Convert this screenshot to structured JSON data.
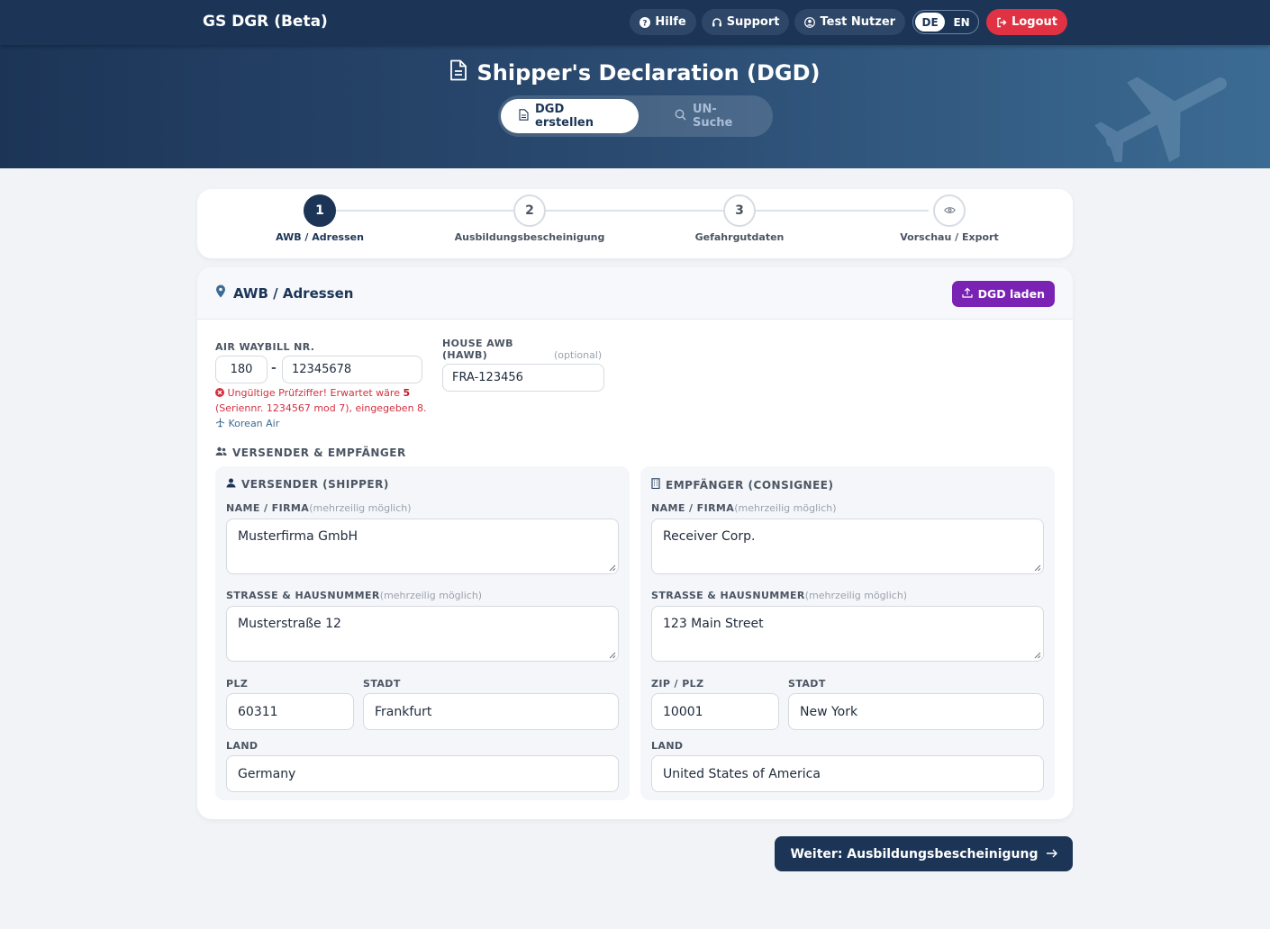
{
  "nav": {
    "brand": "GS DGR (Beta)",
    "help": "Hilfe",
    "support": "Support",
    "user": "Test Nutzer",
    "lang_de": "DE",
    "lang_en": "EN",
    "logout": "Logout"
  },
  "hero": {
    "title": "Shipper's Declaration (DGD)",
    "tabs": [
      {
        "label": "DGD erstellen",
        "active": true
      },
      {
        "label": "UN-Suche",
        "active": false
      }
    ]
  },
  "stepper": {
    "steps": [
      {
        "number": "1",
        "label": "AWB / Adressen",
        "active": true
      },
      {
        "number": "2",
        "label": "Ausbildungsbescheinigung",
        "active": false
      },
      {
        "number": "3",
        "label": "Gefahrgutdaten",
        "active": false
      },
      {
        "number": "",
        "label": "Vorschau / Export",
        "active": false,
        "icon": "eye-icon"
      }
    ]
  },
  "card": {
    "title": "AWB / Adressen",
    "load_button": "DGD laden",
    "awb": {
      "label": "AIR WAYBILL NR.",
      "prefix": "180",
      "separator": "-",
      "number": "12345678",
      "error_text": "Ungültige Prüfziffer! Erwartet wäre",
      "error_expected": "5",
      "error_detail": "(Seriennr. 1234567 mod 7), eingegeben 8.",
      "airline": "Korean Air"
    },
    "hawb": {
      "label_line1": "HOUSE AWB",
      "label_line2": "(HAWB)",
      "optional": "(optional)",
      "value": "FRA-123456"
    },
    "section_title": "VERSENDER & EMPFÄNGER",
    "shipper": {
      "title": "VERSENDER (SHIPPER)",
      "name_label": "NAME / FIRMA",
      "name_hint": "(mehrzeilig möglich)",
      "name": "Musterfirma GmbH",
      "street_label": "STRASSE & HAUSNUMMER",
      "street_hint": "(mehrzeilig möglich)",
      "street": "Musterstraße 12",
      "zip_label": "PLZ",
      "zip": "60311",
      "city_label": "STADT",
      "city": "Frankfurt",
      "country_label": "LAND",
      "country": "Germany"
    },
    "consignee": {
      "title": "EMPFÄNGER (CONSIGNEE)",
      "name_label": "NAME / FIRMA",
      "name_hint": "(mehrzeilig möglich)",
      "name": "Receiver Corp.",
      "street_label": "STRASSE & HAUSNUMMER",
      "street_hint": "(mehrzeilig möglich)",
      "street": "123 Main Street",
      "zip_label": "ZIP / PLZ",
      "zip": "10001",
      "city_label": "STADT",
      "city": "New York",
      "country_label": "LAND",
      "country": "United States of America"
    }
  },
  "next_button": "Weiter: Ausbildungsbescheinigung",
  "colors": {
    "primary": "#1c3557",
    "accent_purple": "#7a22b3",
    "danger": "#e03242",
    "background": "#f1f3f7"
  }
}
